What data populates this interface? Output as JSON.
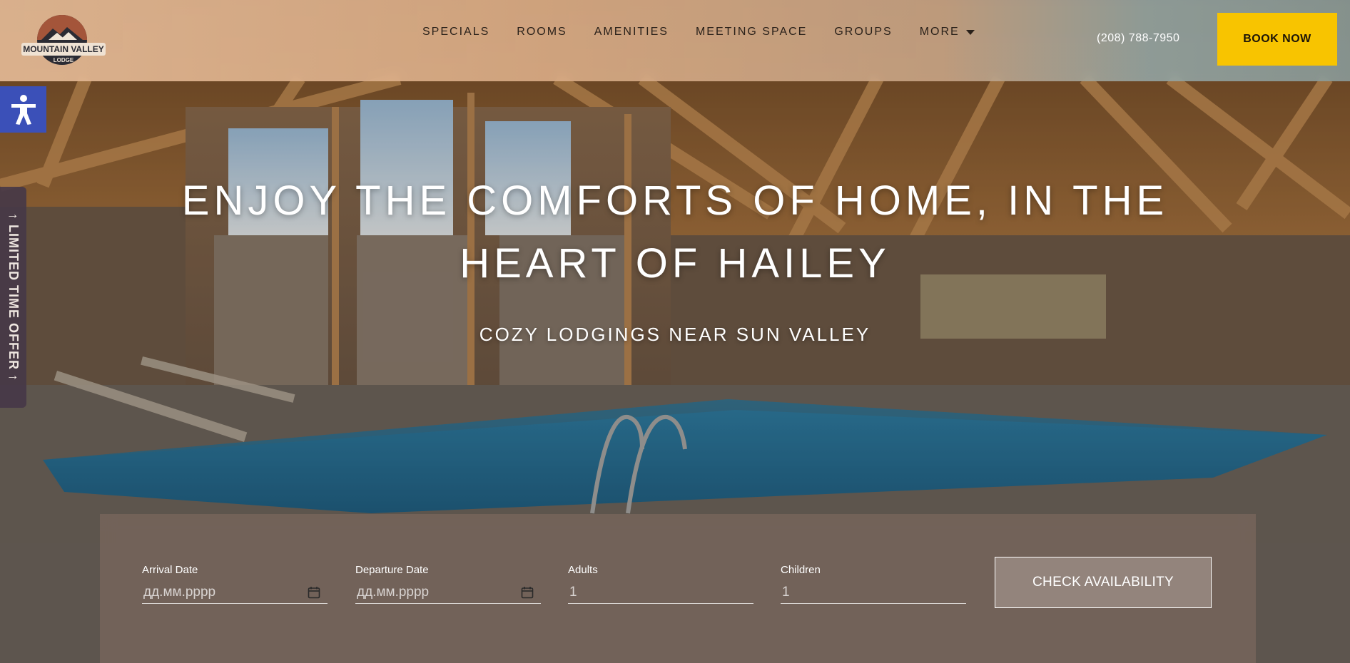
{
  "header": {
    "logo_text_top": "MOUNTAIN VALLEY",
    "logo_text_bottom": "LODGE",
    "nav": [
      {
        "label": "SPECIALS"
      },
      {
        "label": "ROOMS"
      },
      {
        "label": "AMENITIES"
      },
      {
        "label": "MEETING SPACE"
      },
      {
        "label": "GROUPS"
      },
      {
        "label": "MORE"
      }
    ],
    "phone": "(208) 788-7950",
    "book_label": "BOOK NOW"
  },
  "sidebar": {
    "accessibility_icon": "accessibility-icon",
    "offer_label": "↑ LIMITED TIME OFFER ↑"
  },
  "hero": {
    "title_line1": "ENJOY THE COMFORTS OF HOME, IN THE",
    "title_line2": "HEART OF HAILEY",
    "subtitle": "COZY LODGINGS NEAR SUN VALLEY"
  },
  "booking": {
    "arrival_label": "Arrival Date",
    "arrival_placeholder": "дд.мм.рррр",
    "departure_label": "Departure Date",
    "departure_placeholder": "дд.мм.рррр",
    "adults_label": "Adults",
    "adults_value": "1",
    "children_label": "Children",
    "children_value": "1",
    "check_label": "CHECK AVAILABILITY"
  },
  "colors": {
    "book_button": "#f8c400",
    "accessibility_button": "#3b50b8",
    "offer_tab": "#463848"
  }
}
